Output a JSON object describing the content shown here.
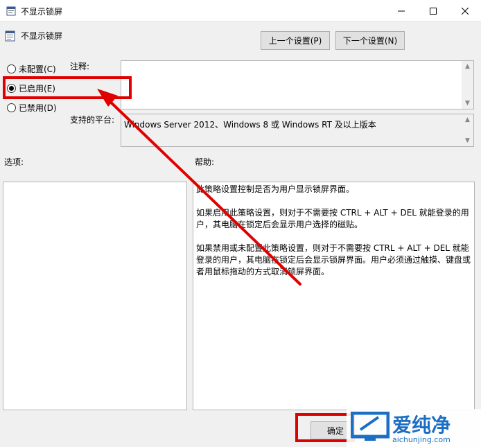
{
  "window": {
    "title": "不显示锁屏",
    "icon": "policy-icon",
    "controls": [
      "minimize-icon",
      "maximize-icon",
      "close-icon"
    ]
  },
  "header": {
    "policy_name": "不显示锁屏",
    "prev_button": "上一个设置(P)",
    "next_button": "下一个设置(N)"
  },
  "state": {
    "options": [
      {
        "label": "未配置(C)",
        "checked": false
      },
      {
        "label": "已启用(E)",
        "checked": true
      },
      {
        "label": "已禁用(D)",
        "checked": false
      }
    ]
  },
  "comment": {
    "label": "注释:",
    "value": ""
  },
  "supported": {
    "label": "支持的平台:",
    "value": "Windows Server 2012、Windows 8 或 Windows RT 及以上版本"
  },
  "options_panel": {
    "label": "选项:"
  },
  "help_panel": {
    "label": "帮助:",
    "paragraphs": [
      "此策略设置控制是否为用户显示锁屏界面。",
      "如果启用此策略设置，则对于不需要按 CTRL + ALT + DEL 就能登录的用户，其电脑在锁定后会显示用户选择的磁贴。",
      "如果禁用或未配置此策略设置，则对于不需要按 CTRL + ALT + DEL 就能登录的用户，其电脑在锁定后会显示锁屏界面。用户必须通过触摸、键盘或者用鼠标拖动的方式取消锁屏界面。"
    ]
  },
  "footer": {
    "ok_button": "确定"
  },
  "annotations": {
    "highlight_color": "#e00000",
    "arrow_color": "#e00000"
  },
  "watermark": {
    "brand": "爱纯净",
    "url": "aichunjing.com",
    "color": "#1a6fc4"
  }
}
